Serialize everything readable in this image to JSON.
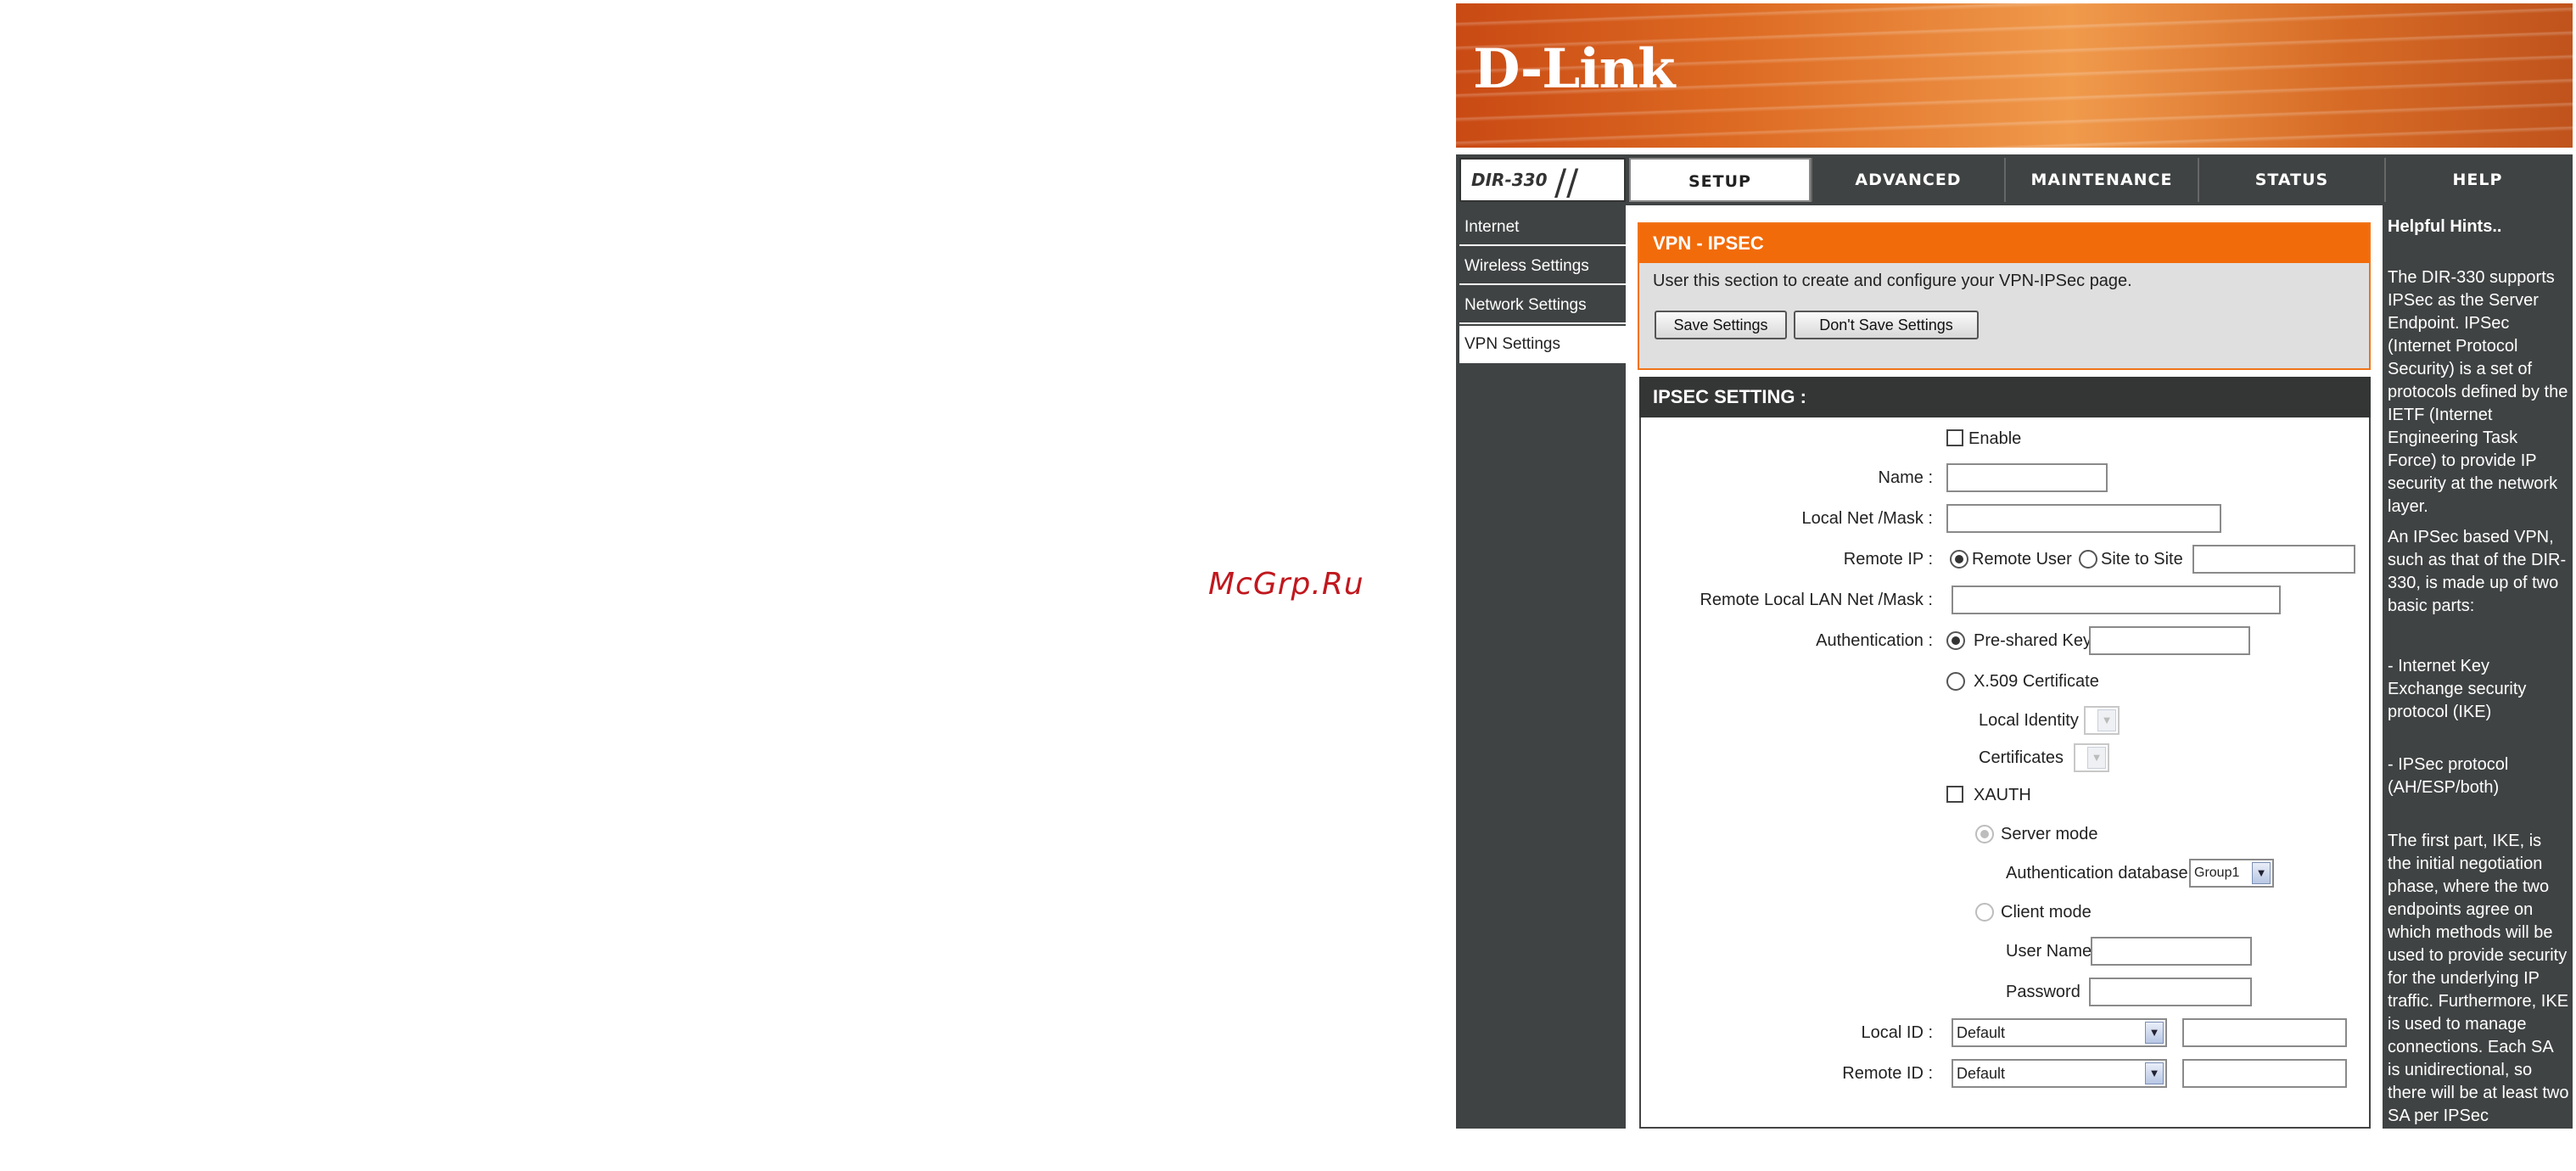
{
  "watermark": "McGrp.Ru",
  "brand": {
    "logo": "D-Link",
    "model": "DIR-330"
  },
  "nav": {
    "tabs": [
      "SETUP",
      "ADVANCED",
      "MAINTENANCE",
      "STATUS",
      "HELP"
    ],
    "active": "SETUP"
  },
  "sidebar": {
    "items": [
      "Internet",
      "Wireless Settings",
      "Network Settings",
      "VPN Settings"
    ],
    "active": "VPN Settings"
  },
  "vpn": {
    "title": "VPN - IPSEC",
    "description": "User this section to create and configure your VPN-IPSec page.",
    "save_label": "Save Settings",
    "dont_save_label": "Don't Save Settings"
  },
  "ipsec": {
    "title": "IPSEC SETTING :",
    "enable_label": "Enable",
    "name_label": "Name :",
    "local_net_label": "Local Net /Mask :",
    "remote_ip_label": "Remote IP :",
    "remote_user_label": "Remote User",
    "site_to_site_label": "Site to Site",
    "remote_lan_label": "Remote Local LAN Net /Mask :",
    "auth_label": "Authentication :",
    "psk_label": "Pre-shared Key",
    "x509_label": "X.509 Certificate",
    "local_identity_label": "Local Identity",
    "certificates_label": "Certificates",
    "xauth_label": "XAUTH",
    "server_mode_label": "Server mode",
    "auth_db_label": "Authentication database",
    "auth_db_value": "Group1",
    "client_mode_label": "Client mode",
    "user_name_label": "User Name",
    "password_label": "Password",
    "local_id_label": "Local ID :",
    "local_id_value": "Default",
    "remote_id_label": "Remote ID :",
    "remote_id_value": "Default"
  },
  "help": {
    "title": "Helpful Hints..",
    "p1": "The DIR-330 supports IPSec as the Server Endpoint. IPSec (Internet Protocol Security) is a set of protocols defined by the IETF (Internet Engineering Task Force) to provide IP security at the network layer.",
    "p2": "An IPSec based VPN, such as that of the DIR-330, is made up of two basic parts:",
    "p3": "- Internet Key Exchange security protocol (IKE)",
    "p4": "- IPSec protocol (AH/ESP/both)",
    "p5": "The first part, IKE, is the initial negotiation phase, where the two endpoints agree on which methods will be used to provide security for the underlying IP traffic. Furthermore, IKE is used to manage connections. Each SA is unidirectional, so there will be at least two SA per IPSec connection."
  }
}
